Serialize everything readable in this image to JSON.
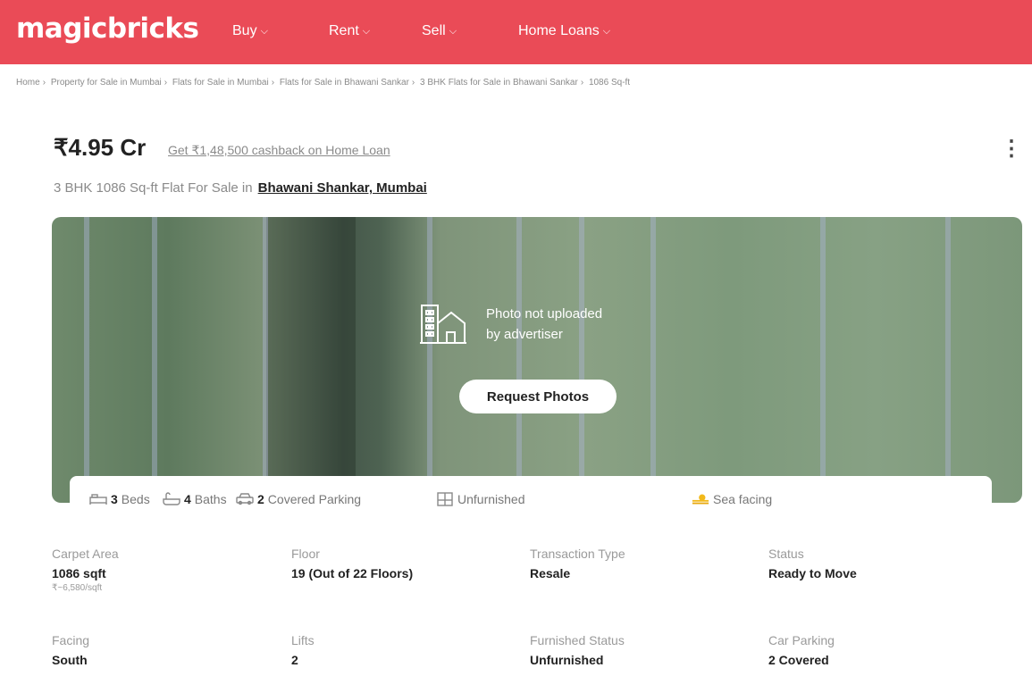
{
  "brand": {
    "logo": "magicbricks",
    "accent": "#ea4b57"
  },
  "nav": [
    {
      "label": "Buy",
      "icon": "chevron-down-icon"
    },
    {
      "label": "Rent",
      "icon": "chevron-down-icon"
    },
    {
      "label": "Sell",
      "icon": "chevron-down-icon"
    },
    {
      "label": "Home Loans",
      "icon": "chevron-down-icon"
    }
  ],
  "breadcrumb": [
    "Home",
    "Property for Sale in Mumbai",
    "Flats for Sale in Mumbai",
    "Flats for Sale in Bhawani Sankar",
    "3 BHK Flats for Sale in Bhawani Sankar",
    "1086 Sq-ft"
  ],
  "listing": {
    "price": "₹4.95 Cr",
    "cashback": "Get ₹1,48,500 cashback on Home Loan",
    "subtitle": "3 BHK 1086 Sq-ft Flat For Sale in",
    "location": "Bhawani Shankar, Mumbai"
  },
  "photo": {
    "message_line1": "Photo not uploaded",
    "message_line2": "by advertiser",
    "request_button": "Request Photos"
  },
  "amenities": {
    "beds_count": "3",
    "beds_label": "Beds",
    "baths_count": "4",
    "baths_label": "Baths",
    "parking_count": "2",
    "parking_label": "Covered Parking",
    "furnishing": "Unfurnished",
    "facing_feature": "Sea facing"
  },
  "details": {
    "carpet_area": {
      "label": "Carpet Area",
      "value": "1086 sqft",
      "sub": "₹~6,580/sqft"
    },
    "floor": {
      "label": "Floor",
      "value": "19 (Out of 22 Floors)"
    },
    "transaction_type": {
      "label": "Transaction Type",
      "value": "Resale"
    },
    "status": {
      "label": "Status",
      "value": "Ready to Move"
    },
    "facing": {
      "label": "Facing",
      "value": "South"
    },
    "lifts": {
      "label": "Lifts",
      "value": "2"
    },
    "furnished_status": {
      "label": "Furnished Status",
      "value": "Unfurnished"
    },
    "car_parking": {
      "label": "Car Parking",
      "value": "2 Covered"
    }
  }
}
